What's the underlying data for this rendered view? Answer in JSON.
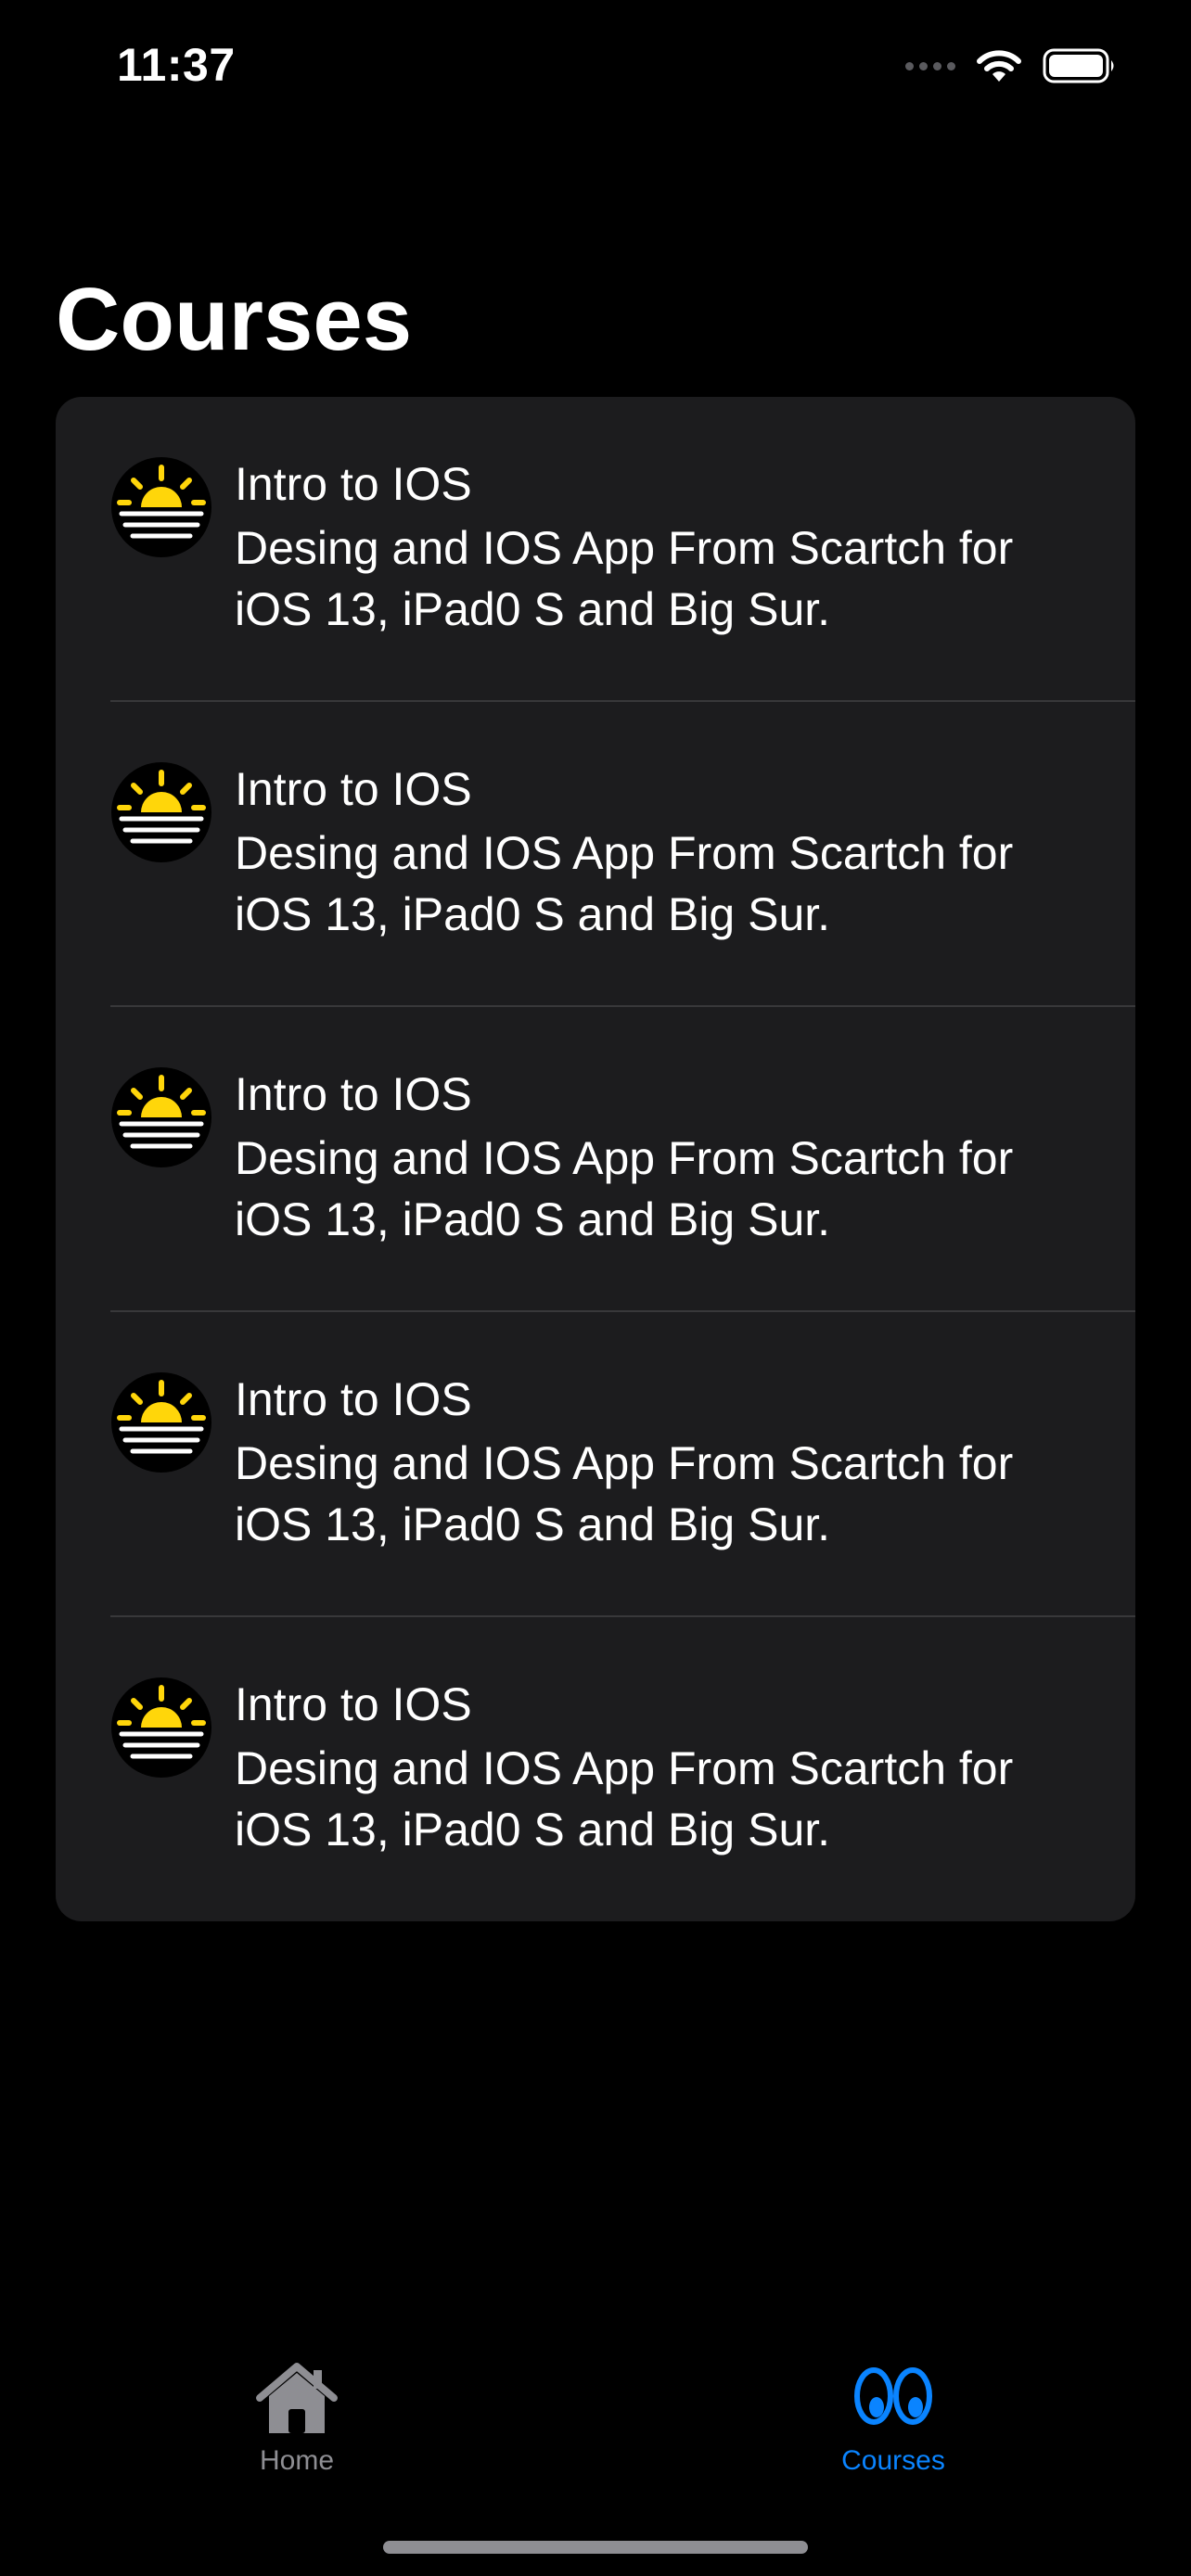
{
  "status_bar": {
    "time": "11:37"
  },
  "page": {
    "title": "Courses"
  },
  "courses": [
    {
      "icon": "sunrise-icon",
      "title": "Intro to IOS",
      "description": "Desing and IOS App From Scartch for iOS 13, iPad0 S and Big Sur."
    },
    {
      "icon": "sunrise-icon",
      "title": "Intro to IOS",
      "description": "Desing and IOS App From Scartch for iOS 13, iPad0 S and Big Sur."
    },
    {
      "icon": "sunrise-icon",
      "title": "Intro to IOS",
      "description": "Desing and IOS App From Scartch for iOS 13, iPad0 S and Big Sur."
    },
    {
      "icon": "sunrise-icon",
      "title": "Intro to IOS",
      "description": "Desing and IOS App From Scartch for iOS 13, iPad0 S and Big Sur."
    },
    {
      "icon": "sunrise-icon",
      "title": "Intro to IOS",
      "description": "Desing and IOS App From Scartch for iOS 13, iPad0 S and Big Sur."
    }
  ],
  "tab_bar": {
    "items": [
      {
        "label": "Home",
        "icon": "house-icon",
        "selected": false
      },
      {
        "label": "Courses",
        "icon": "eyes-icon",
        "selected": true
      }
    ]
  },
  "colors": {
    "background": "#000000",
    "card": "#1c1c1e",
    "accent": "#0a84ff",
    "icon_yellow": "#ffd60a",
    "inactive_tab": "#8e8e93"
  }
}
